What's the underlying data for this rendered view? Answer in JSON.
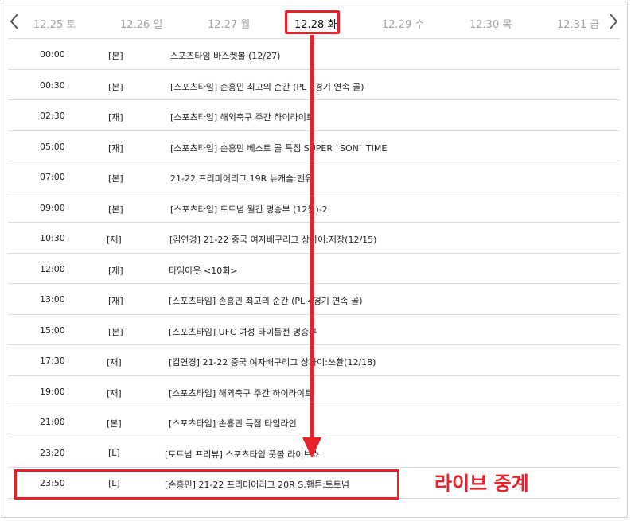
{
  "dates": [
    {
      "label": "12.25 토",
      "active": false
    },
    {
      "label": "12.26 일",
      "active": false
    },
    {
      "label": "12.27 월",
      "active": false
    },
    {
      "label": "12.28 화",
      "active": true
    },
    {
      "label": "12.29 수",
      "active": false
    },
    {
      "label": "12.30 목",
      "active": false
    },
    {
      "label": "12.31 금",
      "active": false
    }
  ],
  "schedule": [
    {
      "time": "00:00",
      "tag": "[본]",
      "title": "스포츠타임 바스켓볼 (12/27)"
    },
    {
      "time": "00:30",
      "tag": "[본]",
      "title": "[스포츠타임] 손흥민 최고의 순간 (PL 4경기 연속 골)"
    },
    {
      "time": "02:30",
      "tag": "[재]",
      "title": "[스포츠타임] 해외축구 주간 하이라이트"
    },
    {
      "time": "05:00",
      "tag": "[재]",
      "title": "[스포츠타임] 손흥민 베스트 골 특집 SUPER `SON` TIME"
    },
    {
      "time": "07:00",
      "tag": "[본]",
      "title": "21-22 프리미어리그 19R 뉴캐슬:맨유"
    },
    {
      "time": "09:00",
      "tag": "[본]",
      "title": "[스포츠타임] 토트넘 월간 명승부 (12월)-2"
    },
    {
      "time": "10:30",
      "tag": "[재]",
      "title": "[김연경] 21-22 중국 여자배구리그 상하이:저장(12/15)"
    },
    {
      "time": "12:00",
      "tag": "[재]",
      "title": "타임아웃 <10회>"
    },
    {
      "time": "13:00",
      "tag": "[재]",
      "title": "[스포츠타임] 손흥민 최고의 순간 (PL 4경기 연속 골)"
    },
    {
      "time": "15:00",
      "tag": "[본]",
      "title": "[스포츠타임] UFC 여성 타이틀전 명승부"
    },
    {
      "time": "17:30",
      "tag": "[재]",
      "title": "[김연경] 21-22 중국 여자배구리그 상하이:쓰촨(12/18)"
    },
    {
      "time": "19:00",
      "tag": "[재]",
      "title": "[스포츠타임] 해외축구 주간 하이라이트"
    },
    {
      "time": "21:00",
      "tag": "[본]",
      "title": "[스포츠타임] 손흥민 득점 타임라인"
    },
    {
      "time": "23:20",
      "tag": "[L]",
      "title": "[토트넘 프리뷰] 스포츠타임 풋볼 라이브쇼"
    },
    {
      "time": "23:50",
      "tag": "[L]",
      "title": "[손흥민] 21-22 프리미어리그 20R S.햄튼:토트넘"
    }
  ],
  "annotation": {
    "label": "라이브 중계",
    "color": "#e8212b"
  },
  "icons": {
    "prev": "chevron-left-icon",
    "next": "chevron-right-icon"
  }
}
